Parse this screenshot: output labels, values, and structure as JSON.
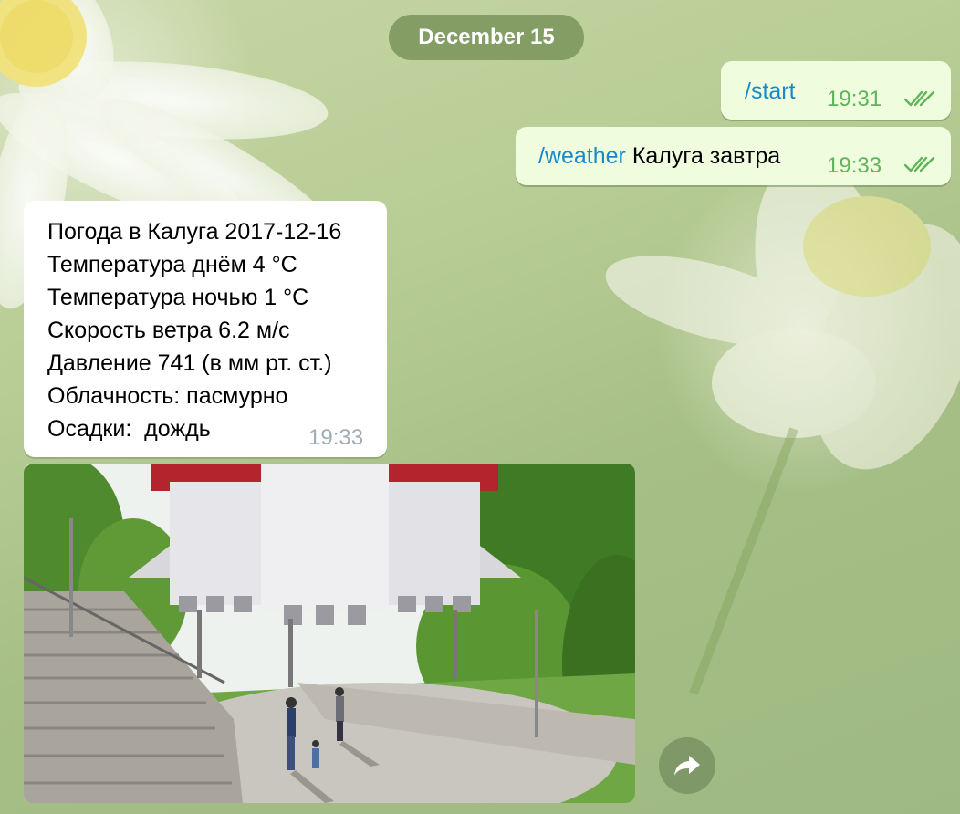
{
  "chat": {
    "date_label": "December 15",
    "messages": [
      {
        "direction": "out",
        "command": "/start",
        "text": "",
        "time": "19:31",
        "status_icon": "double-check-icon"
      },
      {
        "direction": "out",
        "command": "/weather",
        "text": " Калуга завтра",
        "time": "19:33",
        "status_icon": "double-check-icon"
      }
    ],
    "reply": {
      "lines": [
        "Погода в Калуга 2017-12-16",
        "Температура днём 4 °C",
        "Температура ночью 1 °C",
        "Скорость ветра 6.2 м/с",
        "Давление 741 (в мм рт. ст.)",
        "Облачность: пасмурно",
        "Осадки:  дождь"
      ],
      "time": "19:33"
    },
    "share_icon": "share-arrow-icon"
  },
  "colors": {
    "outgoing_bubble": "#effdde",
    "command_link": "#168acd",
    "outgoing_time": "#5fb45a",
    "incoming_time": "#a0acb6",
    "date_pill": "#79945c"
  }
}
